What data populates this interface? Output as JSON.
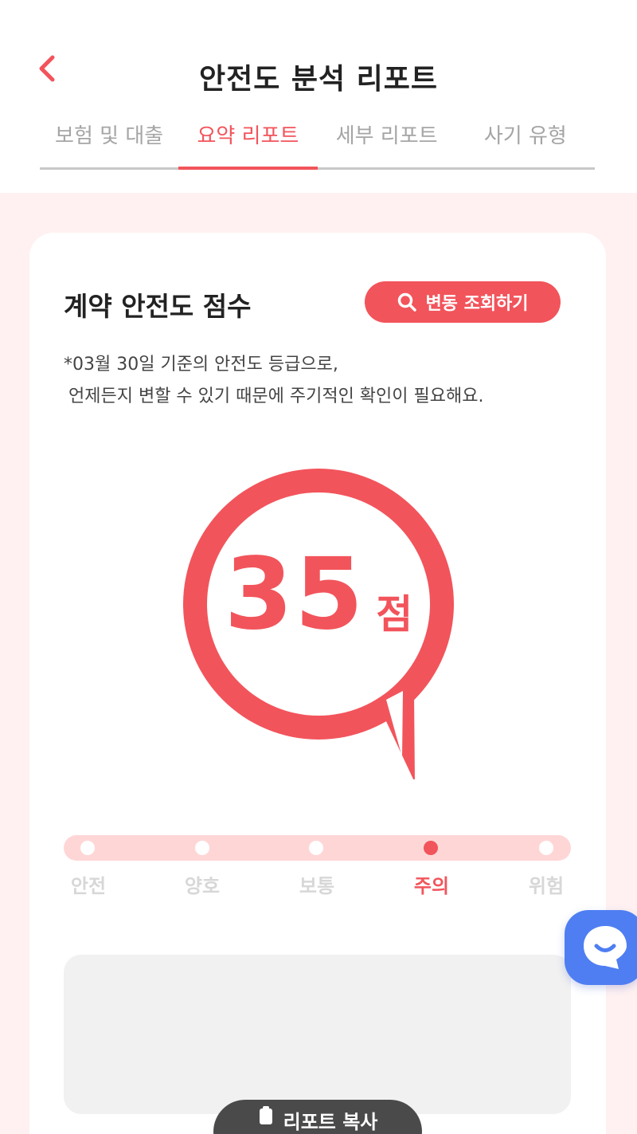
{
  "header": {
    "title": "안전도 분석 리포트",
    "tabs": [
      {
        "label": "보험 및 대출"
      },
      {
        "label": "요약 리포트"
      },
      {
        "label": "세부 리포트"
      },
      {
        "label": "사기 유형"
      }
    ],
    "active_tab": "요약 리포트"
  },
  "card": {
    "title": "계약 안전도 점수",
    "change_button_label": "변동 조회하기",
    "notice_line1": "*03월 30일 기준의 안전도 등급으로,",
    "notice_line2": "언제든지 변할 수 있기 때문에 주기적인 확인이 필요해요.",
    "score_value": "35",
    "score_unit": "점",
    "levels": [
      {
        "label": "안전"
      },
      {
        "label": "양호"
      },
      {
        "label": "보통"
      },
      {
        "label": "주의"
      },
      {
        "label": "위험"
      }
    ],
    "current_level": "주의",
    "report_button_label": "리포트 복사"
  },
  "icons": {
    "back": "chevron-left-icon",
    "search": "search-icon",
    "chat": "chat-icon"
  },
  "colors": {
    "accent": "#f2545b",
    "background_tint": "#fff1f1",
    "level_bar": "#ffd6d6",
    "chat_fab": "#4f7ef2"
  }
}
